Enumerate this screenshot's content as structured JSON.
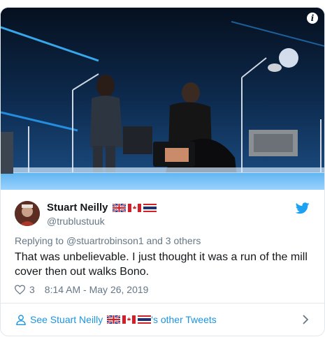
{
  "tweet": {
    "author_name": "Stuart Neilly",
    "author_flags": [
      "uk-flag",
      "canada-flag",
      "thailand-flag"
    ],
    "author_handle": "@trublustuuk",
    "reply_prefix": "Replying to",
    "reply_to": "@stuartrobinson1",
    "reply_suffix": "and 3 others",
    "text": "That was unbelievable. I just thought it was a run of the mill cover then out walks Bono.",
    "likes": "3",
    "timestamp": "8:14 AM - May 26, 2019"
  },
  "footer": {
    "see_prefix": "See Stuart Neilly",
    "see_suffix": "'s other Tweets"
  },
  "media": {
    "info_label": "i",
    "description_icon": "concert-photo"
  },
  "colors": {
    "link_blue": "#1b95e0",
    "muted": "#657786",
    "text": "#14171a",
    "twitter_blue": "#1da1f2"
  }
}
